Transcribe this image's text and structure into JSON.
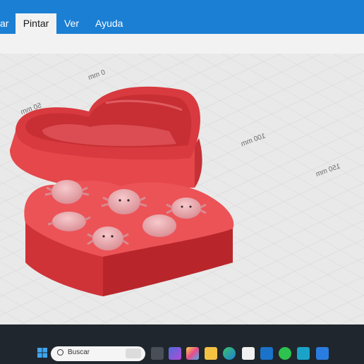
{
  "menubar": {
    "items": [
      {
        "label": "ar"
      },
      {
        "label": "Pintar",
        "active": true
      },
      {
        "label": "Ver"
      },
      {
        "label": "Ayuda"
      }
    ]
  },
  "viewport": {
    "ruler_labels": [
      "0 mm",
      "50 mm",
      "100 mm",
      "150 mm"
    ],
    "model_color": "#e8484c"
  },
  "taskbar": {
    "search_placeholder": "Buscar",
    "icons": [
      "windows-icon",
      "widgets-icon",
      "task-view-icon",
      "copilot-icon",
      "paint-icon",
      "file-explorer-icon",
      "edge-icon",
      "store-icon",
      "outlook-icon",
      "whatsapp-icon",
      "slicer-icon",
      "app-c-icon"
    ]
  }
}
